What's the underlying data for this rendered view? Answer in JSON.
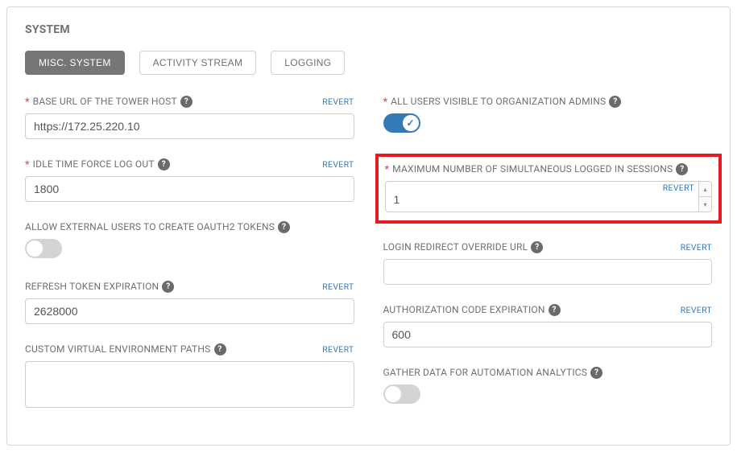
{
  "title": "SYSTEM",
  "tabs": {
    "misc": "MISC. SYSTEM",
    "activity": "ACTIVITY STREAM",
    "logging": "LOGGING"
  },
  "revert_label": "REVERT",
  "left": {
    "base_url": {
      "label": "BASE URL OF THE TOWER HOST",
      "value": "https://172.25.220.10"
    },
    "idle_timeout": {
      "label": "IDLE TIME FORCE LOG OUT",
      "value": "1800"
    },
    "oauth2": {
      "label": "ALLOW EXTERNAL USERS TO CREATE OAUTH2 TOKENS"
    },
    "refresh_token": {
      "label": "REFRESH TOKEN EXPIRATION",
      "value": "2628000"
    },
    "venv": {
      "label": "CUSTOM VIRTUAL ENVIRONMENT PATHS",
      "value": ""
    }
  },
  "right": {
    "all_users_visible": {
      "label": "ALL USERS VISIBLE TO ORGANIZATION ADMINS"
    },
    "max_sessions": {
      "label": "MAXIMUM NUMBER OF SIMULTANEOUS LOGGED IN SESSIONS",
      "value": "1"
    },
    "login_redirect": {
      "label": "LOGIN REDIRECT OVERRIDE URL",
      "value": ""
    },
    "auth_code": {
      "label": "AUTHORIZATION CODE EXPIRATION",
      "value": "600"
    },
    "gather_data": {
      "label": "GATHER DATA FOR AUTOMATION ANALYTICS"
    }
  }
}
